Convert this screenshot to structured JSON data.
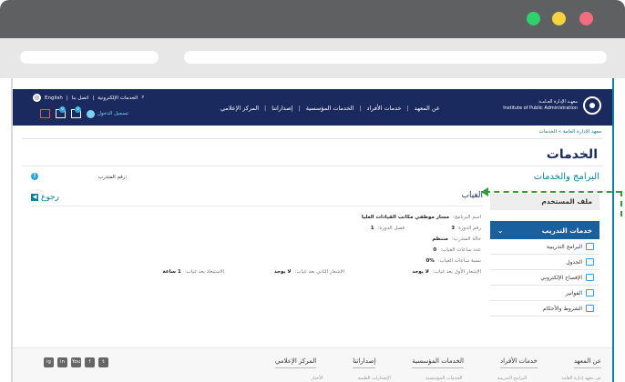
{
  "browser": {
    "title": ""
  },
  "header": {
    "top_links": {
      "language": "English",
      "contact": "اتصل بنا",
      "eservices": "الخدمات الإلكترونية"
    },
    "login": "تسجيل الدخول",
    "nav": [
      "عن المعهد",
      "خدمات الأفراد",
      "الخدمات المؤسسية",
      "إصداراتنا",
      "المركز الإعلامي"
    ],
    "logo": {
      "ar": "معهـد الإدارة العـامـة",
      "en": "Institute of Public Administration"
    },
    "badges": [
      "0",
      "0"
    ]
  },
  "breadcrumb": {
    "home": "معهد الإدارة العامة",
    "current": "الخدمات"
  },
  "page": {
    "title": "الخدمات",
    "subtitle": "البرامج والخدمات"
  },
  "sidebar": {
    "profile": "ملف المستخدم",
    "section": "خدمات التدريب",
    "items": [
      {
        "label": "البرامج التدريبية",
        "icon": "programs-icon"
      },
      {
        "label": "الجدول",
        "icon": "table-icon"
      },
      {
        "label": "الإفصاح الإلكتروني",
        "icon": "disclosure-icon"
      },
      {
        "label": "الفواتير",
        "icon": "invoice-icon"
      },
      {
        "label": "الشروط والأحكام",
        "icon": "terms-icon"
      }
    ]
  },
  "content": {
    "trainee_label": "رقم المتدرب:",
    "info_mark": "!",
    "back": "رجوع",
    "section_title": "الغياب",
    "fields": {
      "program_name_lbl": "اسم البرنامج:",
      "program_name_val": "مسار موظفي مكاتب القيادات العليا",
      "session_lbl": "رقم الدورة",
      "session_val": "3",
      "term_lbl": "فصل الدورة:",
      "term_val": "1",
      "status_lbl": "حالة المتدرب:",
      "status_val": "منتظم",
      "hours_lbl": "عدد ساعات الغياب:",
      "hours_val": "0",
      "pct_lbl": "نسبة ساعات الغياب:",
      "pct_val": "%0",
      "notice1_lbl": "الإشعار الأول بعد غياب:",
      "notice1_val": "لا يوجد",
      "notice2_lbl": "الإشعار الثاني بعد غياب:",
      "notice2_val": "لا يوجد",
      "exclude_lbl": "الاستبعاد بعد غياب:",
      "exclude_val": "1 ساعة"
    }
  },
  "footer": {
    "nav": [
      "عن المعهد",
      "خدمات الأفراد",
      "الخدمات المؤسسية",
      "إصداراتنا",
      "المركز الإعلامي"
    ],
    "sub": [
      "عن معهد إدارة العامة",
      "البرامج التدريبية",
      "الخدمات المؤسسية",
      "الإصدارات العلمية",
      "الأخبار"
    ],
    "social": [
      "in",
      "You",
      "f",
      "t",
      "ig"
    ]
  },
  "colors": {
    "header": "#1a2a5e",
    "accent": "#0d7fa0",
    "callout": "#2f9e3a"
  }
}
